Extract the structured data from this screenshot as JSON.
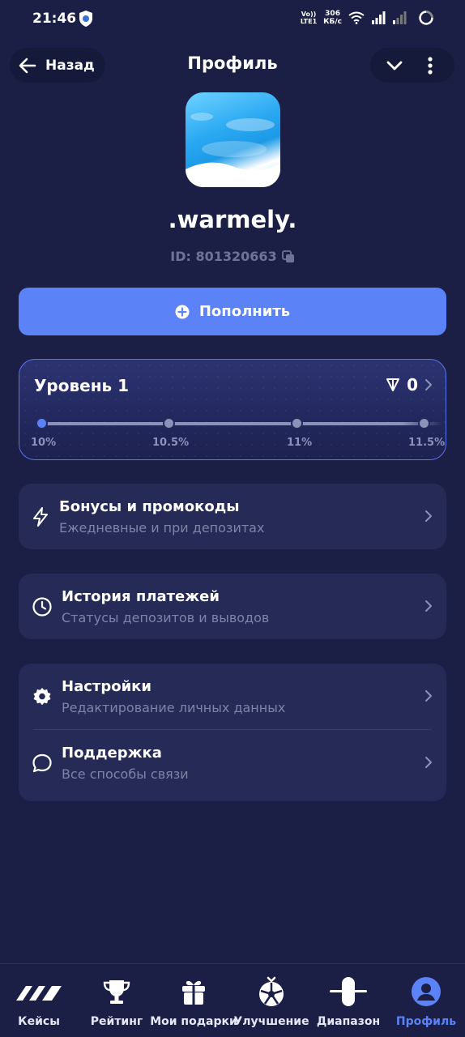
{
  "status_bar": {
    "time": "21:46",
    "volte_top": "Vo))",
    "volte_bottom": "LTE1",
    "speed_top": "306",
    "speed_bottom": "КБ/с"
  },
  "header": {
    "back_label": "Назад",
    "title": "Профиль"
  },
  "profile": {
    "username": ".warmely.",
    "id_text": "ID: 801320663"
  },
  "topup": {
    "label": "Пополнить"
  },
  "level": {
    "title": "Уровень 1",
    "balance": "0",
    "ticks": [
      "10%",
      "10.5%",
      "11%",
      "11.5%"
    ]
  },
  "menu": {
    "bonuses": {
      "title": "Бонусы и промокоды",
      "subtitle": "Ежедневные и при депозитах"
    },
    "payments": {
      "title": "История платежей",
      "subtitle": "Статусы депозитов и выводов"
    },
    "settings": {
      "title": "Настройки",
      "subtitle": "Редактирование личных данных"
    },
    "support": {
      "title": "Поддержка",
      "subtitle": "Все способы связи"
    }
  },
  "nav": {
    "items": [
      "Кейсы",
      "Рейтинг",
      "Мои подарки",
      "Улучшение",
      "Диапазон",
      "Профиль"
    ],
    "active": "Профиль"
  },
  "colors": {
    "background": "#1b1f45",
    "accent": "#5b82f6",
    "card": "#252a57",
    "muted_text": "#7e84a8"
  }
}
